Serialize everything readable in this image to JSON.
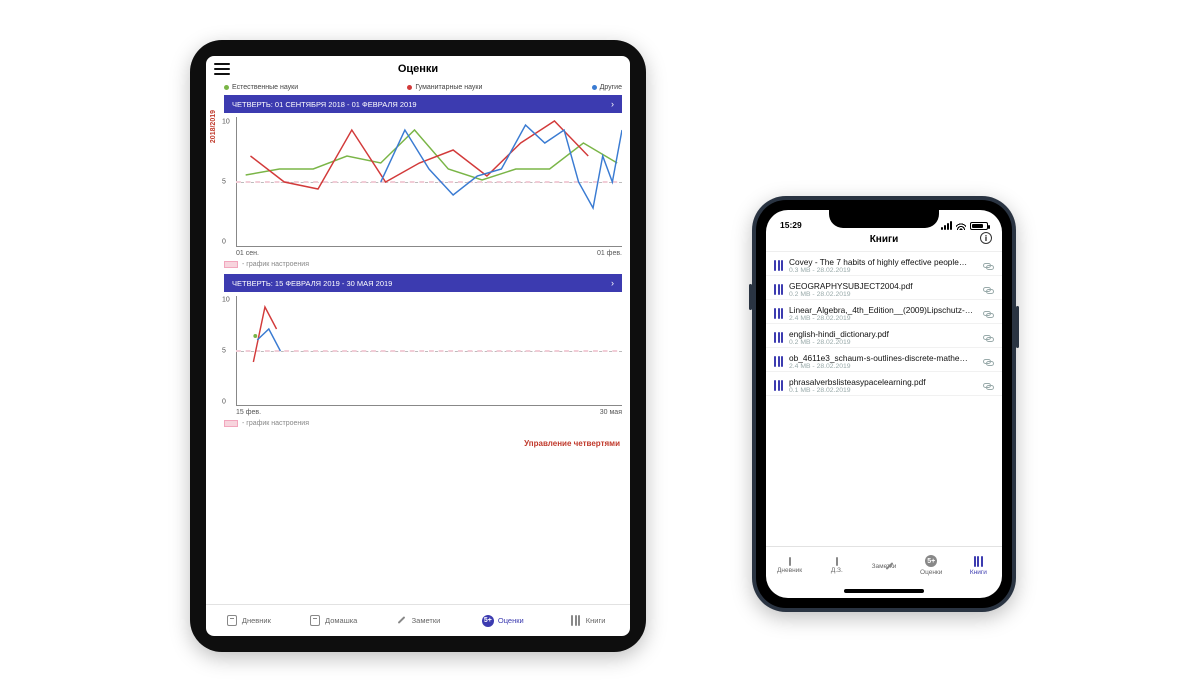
{
  "ipad": {
    "title": "Оценки",
    "year_label": "2018/2019",
    "legend": [
      {
        "label": "Естественные науки",
        "color": "#7ab547"
      },
      {
        "label": "Гуманитарные науки",
        "color": "#d23a3a"
      },
      {
        "label": "Другие",
        "color": "#3a7bd2"
      }
    ],
    "period1": {
      "label": "ЧЕТВЕРТЬ: 01 СЕНТЯБРЯ 2018 - 01 ФЕВРАЛЯ 2019"
    },
    "period2": {
      "label": "ЧЕТВЕРТЬ: 15 ФЕВРАЛЯ 2019 - 30 МАЯ 2019"
    },
    "chart1": {
      "yticks": [
        "10",
        "5",
        "0"
      ],
      "xstart": "01 сен.",
      "xend": "01 фев.",
      "mood_caption": "- график настроения"
    },
    "chart2": {
      "yticks": [
        "10",
        "5",
        "0"
      ],
      "xstart": "15 фев.",
      "xend": "30 мая",
      "mood_caption": "- график настроения"
    },
    "manage_label": "Управление четвертями",
    "tabs": [
      {
        "label": "Дневник"
      },
      {
        "label": "Домашка"
      },
      {
        "label": "Заметки"
      },
      {
        "label": "Оценки",
        "active": true,
        "glyph": "5+"
      },
      {
        "label": "Книги"
      }
    ]
  },
  "iphone": {
    "time": "15:29",
    "title": "Книги",
    "files": [
      {
        "name": "Covey - The 7 habits of highly effective people…",
        "meta": "0.3 MB - 28.02.2019"
      },
      {
        "name": "GEOGRAPHYSUBJECT2004.pdf",
        "meta": "0.2 MB - 28.02.2019"
      },
      {
        "name": "Linear_Algebra,_4th_Edition__(2009)Lipschutz-…",
        "meta": "2.4 MB - 28.02.2019"
      },
      {
        "name": "english-hindi_dictionary.pdf",
        "meta": "0.2 MB - 28.02.2019"
      },
      {
        "name": "ob_4611e3_schaum-s-outlines-discrete-mathe…",
        "meta": "2.4 MB - 28.02.2019"
      },
      {
        "name": "phrasalverbslisteasypacelearning.pdf",
        "meta": "0.1 MB - 28.02.2019"
      }
    ],
    "tabs": [
      {
        "label": "Дневник"
      },
      {
        "label": "Д.З."
      },
      {
        "label": "Заметки"
      },
      {
        "label": "Оценки",
        "glyph": "5+"
      },
      {
        "label": "Книги",
        "active": true
      }
    ]
  },
  "chart_data": [
    {
      "type": "line",
      "title": "ЧЕТВЕРТЬ: 01 СЕНТЯБРЯ 2018 - 01 ФЕВРАЛЯ 2019",
      "ylim": [
        0,
        10
      ],
      "x_range": [
        "01 сен.",
        "01 фев."
      ],
      "series": [
        {
          "name": "Естественные науки",
          "color": "#7ab547",
          "values": [
            5.5,
            6,
            6,
            7,
            6.5,
            9,
            6,
            5.2,
            6,
            6,
            8,
            6.5
          ]
        },
        {
          "name": "Гуманитарные науки",
          "color": "#d23a3a",
          "values": [
            7,
            5,
            4.5,
            9,
            5,
            6.5,
            7.5,
            5.5,
            8,
            10,
            7
          ]
        },
        {
          "name": "Другие",
          "color": "#3a7bd2",
          "values": [
            5,
            9,
            6,
            4,
            5.5,
            6,
            9.5,
            8,
            9,
            5,
            3,
            7,
            5,
            9
          ]
        },
        {
          "name": "график настроения",
          "color": "#f2cdd7",
          "style": "dashed",
          "values": [
            5,
            5,
            5,
            5,
            5,
            5,
            5,
            5,
            5,
            5,
            5,
            5
          ]
        }
      ]
    },
    {
      "type": "line",
      "title": "ЧЕТВЕРТЬ: 15 ФЕВРАЛЯ 2019 - 30 МАЯ 2019",
      "ylim": [
        0,
        10
      ],
      "x_range": [
        "15 фев.",
        "30 мая"
      ],
      "series": [
        {
          "name": "Естественные науки",
          "color": "#7ab547",
          "values": [
            6.5
          ]
        },
        {
          "name": "Гуманитарные науки",
          "color": "#d23a3a",
          "values": [
            4,
            9,
            7
          ]
        },
        {
          "name": "Другие",
          "color": "#3a7bd2",
          "values": [
            6,
            7,
            5
          ]
        },
        {
          "name": "график настроения",
          "color": "#f2cdd7",
          "style": "dashed",
          "values": [
            5,
            5,
            5,
            5,
            5,
            5,
            5,
            5,
            5,
            5,
            5,
            5
          ]
        }
      ]
    }
  ]
}
